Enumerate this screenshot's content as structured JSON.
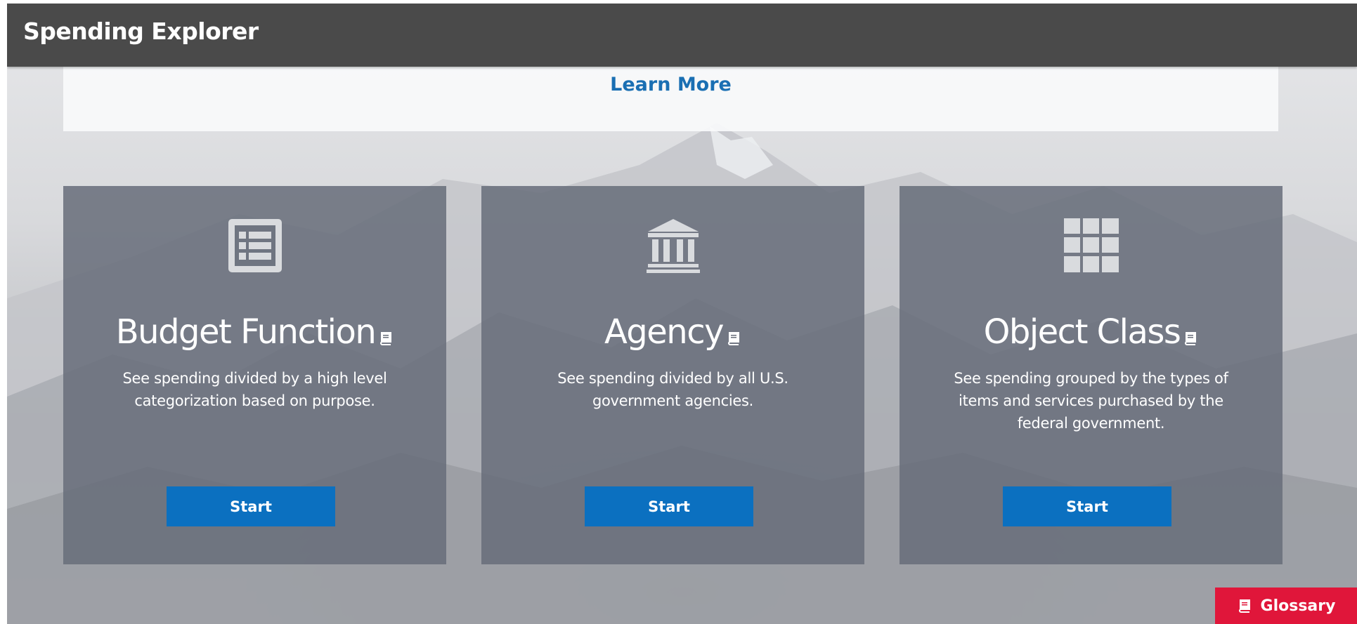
{
  "header": {
    "title": "Spending Explorer"
  },
  "intro": {
    "learn_more": "Learn More"
  },
  "cards": [
    {
      "icon": "list-document-icon",
      "title": "Budget Function",
      "description": "See spending divided by a high level categorization based on purpose.",
      "button": "Start"
    },
    {
      "icon": "government-building-icon",
      "title": "Agency",
      "description": "See spending divided by all U.S. government agencies.",
      "button": "Start"
    },
    {
      "icon": "grid-icon",
      "title": "Object Class",
      "description": "See spending grouped by the types of items and services purchased by the federal government.",
      "button": "Start"
    }
  ],
  "glossary": {
    "label": "Glossary",
    "icon": "book-icon"
  },
  "colors": {
    "header_bg": "#4a4a4a",
    "link": "#1a6fb3",
    "button": "#0b70c0",
    "glossary_tab": "#e0163a",
    "card_bg": "#686e7a"
  }
}
